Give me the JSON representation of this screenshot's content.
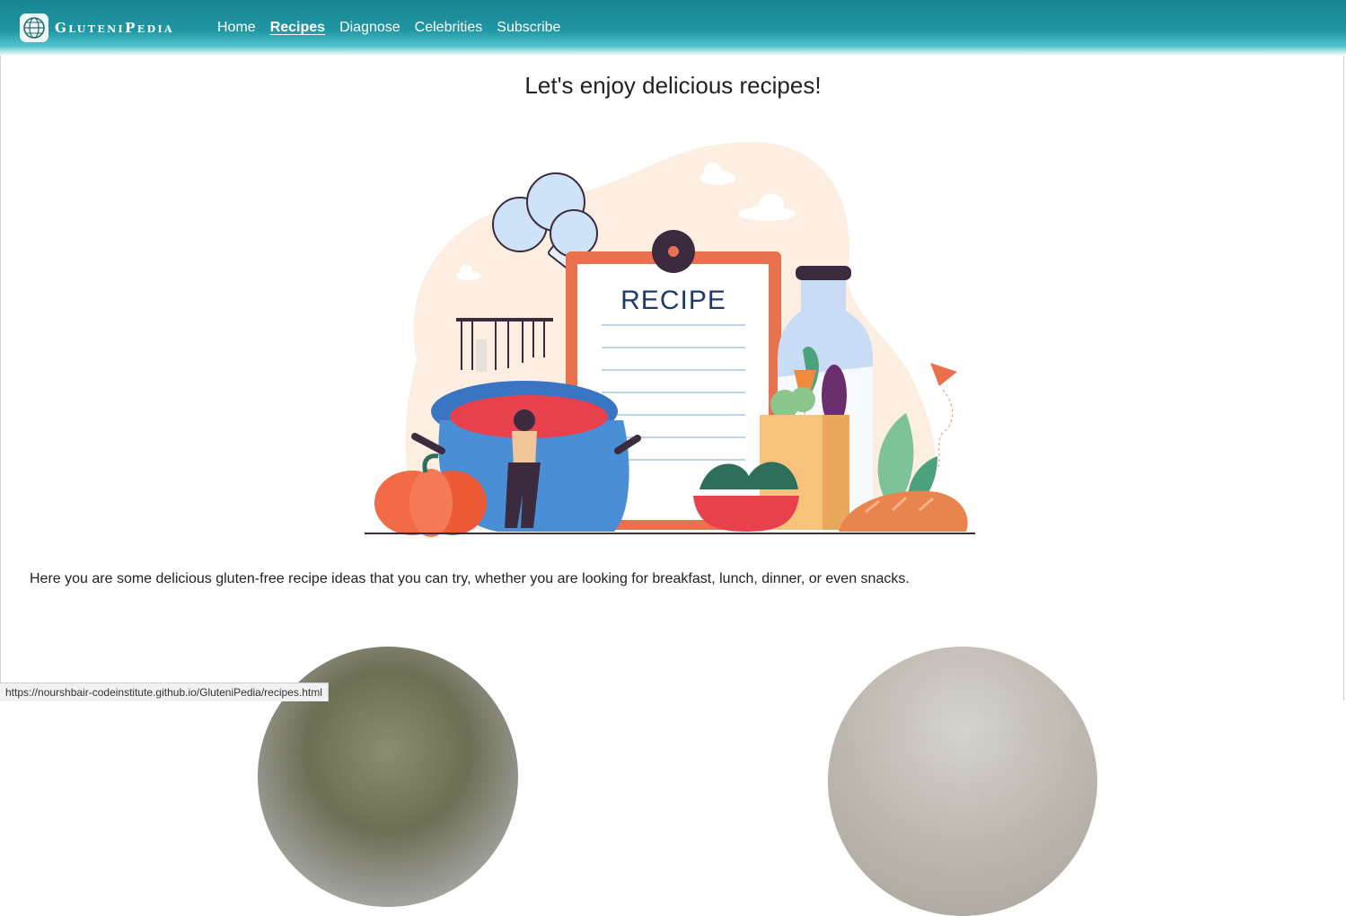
{
  "brand": {
    "name": "GluteniPedia",
    "logo_icon": "globe-logo-icon"
  },
  "nav": {
    "items": [
      {
        "label": "Home",
        "active": false
      },
      {
        "label": "Recipes",
        "active": true
      },
      {
        "label": "Diagnose",
        "active": false
      },
      {
        "label": "Celebrities",
        "active": false
      },
      {
        "label": "Subscribe",
        "active": false
      }
    ]
  },
  "main": {
    "title": "Let's enjoy delicious recipes!",
    "illustration": {
      "clipboard_text": "RECIPE"
    },
    "intro": "Here you are some delicious gluten-free recipe ideas that you can try, whether you are looking for breakfast, lunch, dinner, or even snacks."
  },
  "status_bar": {
    "url": "https://nourshbair-codeinstitute.github.io/GluteniPedia/recipes.html"
  },
  "colors": {
    "nav_teal": "#1f97a3",
    "blob": "#fdeee2",
    "pot_blue": "#4a8fd6",
    "orange": "#f26a45"
  }
}
